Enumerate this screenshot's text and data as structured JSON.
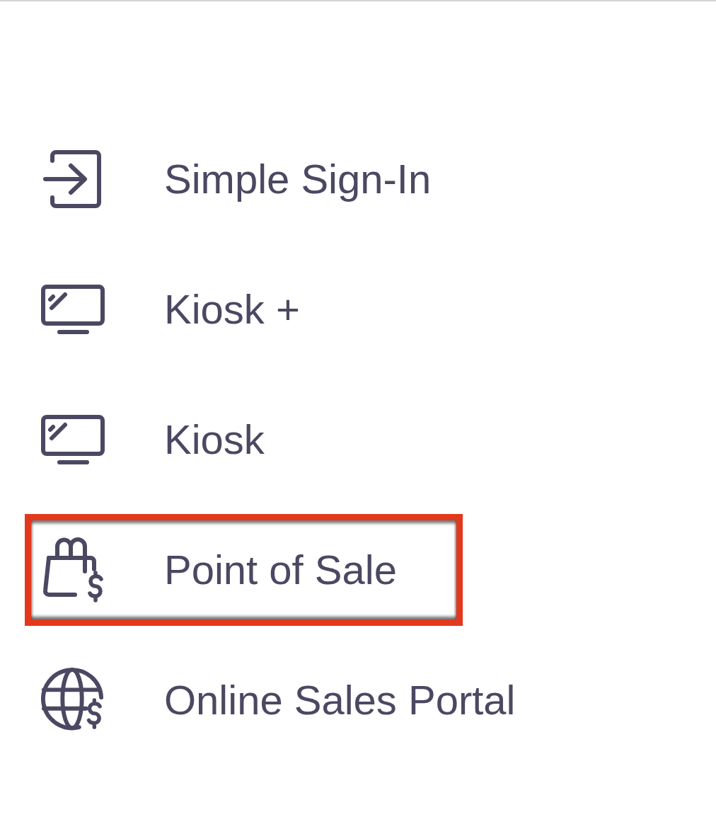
{
  "menu": {
    "items": [
      {
        "label": "Simple Sign-In",
        "kind": "sign-in",
        "highlighted": false
      },
      {
        "label": "Kiosk +",
        "kind": "monitor",
        "highlighted": false
      },
      {
        "label": "Kiosk",
        "kind": "monitor",
        "highlighted": false
      },
      {
        "label": "Point of Sale",
        "kind": "bag",
        "highlighted": true
      },
      {
        "label": "Online Sales Portal",
        "kind": "globe",
        "highlighted": false
      }
    ]
  }
}
